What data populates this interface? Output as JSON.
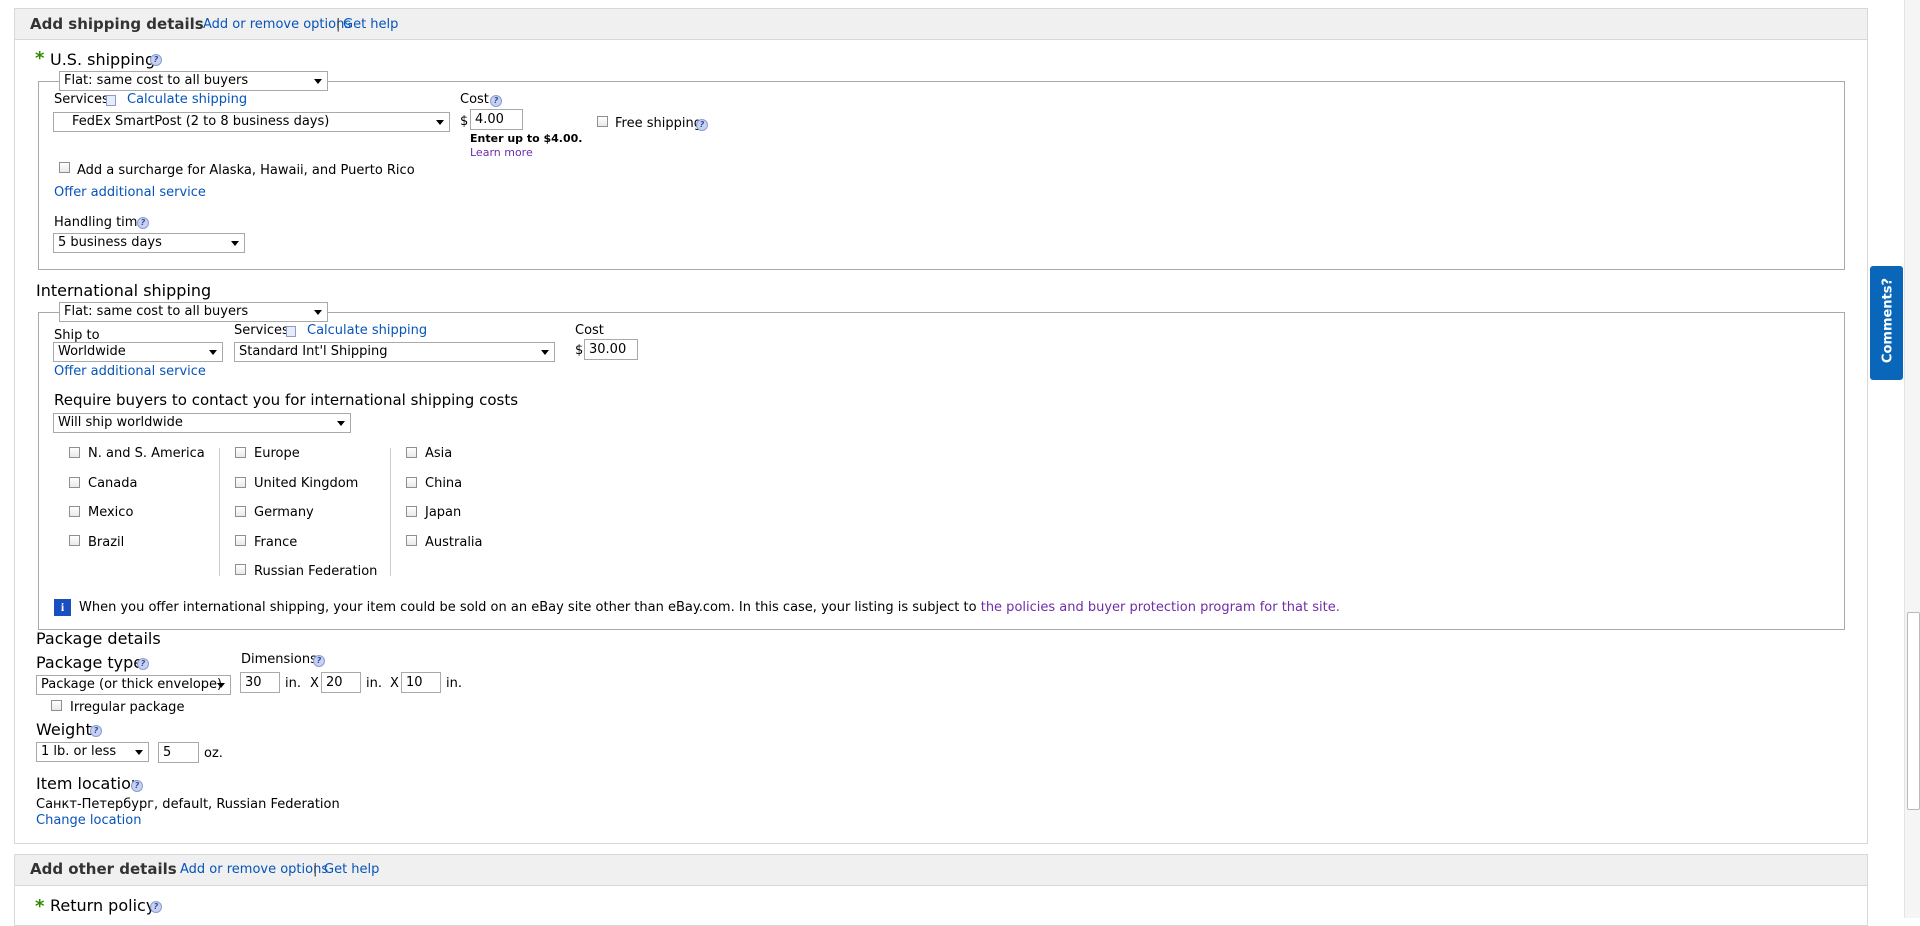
{
  "shipping_section": {
    "title": "Add shipping details",
    "add_remove": "Add or remove options",
    "sep": "|",
    "get_help": "Get help"
  },
  "us_shipping": {
    "star": "*",
    "title": "U.S. shipping",
    "type": "Flat: same cost to all buyers",
    "services_label": "Services",
    "calculate": "Calculate shipping",
    "service": "FedEx SmartPost (2 to 8 business days)",
    "cost_label": "Cost",
    "currency": "$",
    "cost": "4.00",
    "enter_up": "Enter up to $4.00.",
    "learn_more": "Learn more",
    "free_shipping": "Free shipping",
    "surcharge": "Add a surcharge for Alaska, Hawaii, and Puerto Rico",
    "offer_additional": "Offer additional service",
    "handling_label": "Handling time",
    "handling": "5 business days"
  },
  "intl_shipping": {
    "title": "International shipping",
    "type": "Flat: same cost to all buyers",
    "ship_to_label": "Ship to",
    "ship_to": "Worldwide",
    "services_label": "Services",
    "calculate": "Calculate shipping",
    "service": "Standard Int'l Shipping",
    "cost_label": "Cost",
    "currency": "$",
    "cost": "30.00",
    "offer_additional": "Offer additional service",
    "require_label": "Require buyers to contact you for international shipping costs",
    "require": "Will ship worldwide",
    "regions": [
      [
        "N. and S. America",
        "Canada",
        "Mexico",
        "Brazil"
      ],
      [
        "Europe",
        "United Kingdom",
        "Germany",
        "France",
        "Russian Federation"
      ],
      [
        "Asia",
        "China",
        "Japan",
        "Australia"
      ]
    ],
    "info_icon": "i",
    "info_text": "When you offer international shipping, your item could be sold on an eBay site other than eBay.com. In this case, your listing is subject to ",
    "info_link": "the policies and buyer protection program for that site."
  },
  "package": {
    "title": "Package details",
    "type_label": "Package type",
    "type": "Package (or thick envelope)",
    "dimensions_label": "Dimensions",
    "dim1": "30",
    "dim2": "20",
    "dim3": "10",
    "unit_in": "in.",
    "x": "X",
    "irregular": "Irregular package",
    "weight_label": "Weight",
    "weight_lb": "1 lb. or less",
    "weight_oz": "5",
    "unit_oz": "oz."
  },
  "location": {
    "title": "Item location",
    "value": "Санкт-Петербург, default, Russian Federation",
    "change": "Change location"
  },
  "other_section": {
    "title": "Add other details",
    "add_remove": "Add or remove options",
    "sep": "|",
    "get_help": "Get help"
  },
  "return_policy": {
    "star": "*",
    "title": "Return policy"
  },
  "comments_tab": "Comments?",
  "help_glyph": "?"
}
